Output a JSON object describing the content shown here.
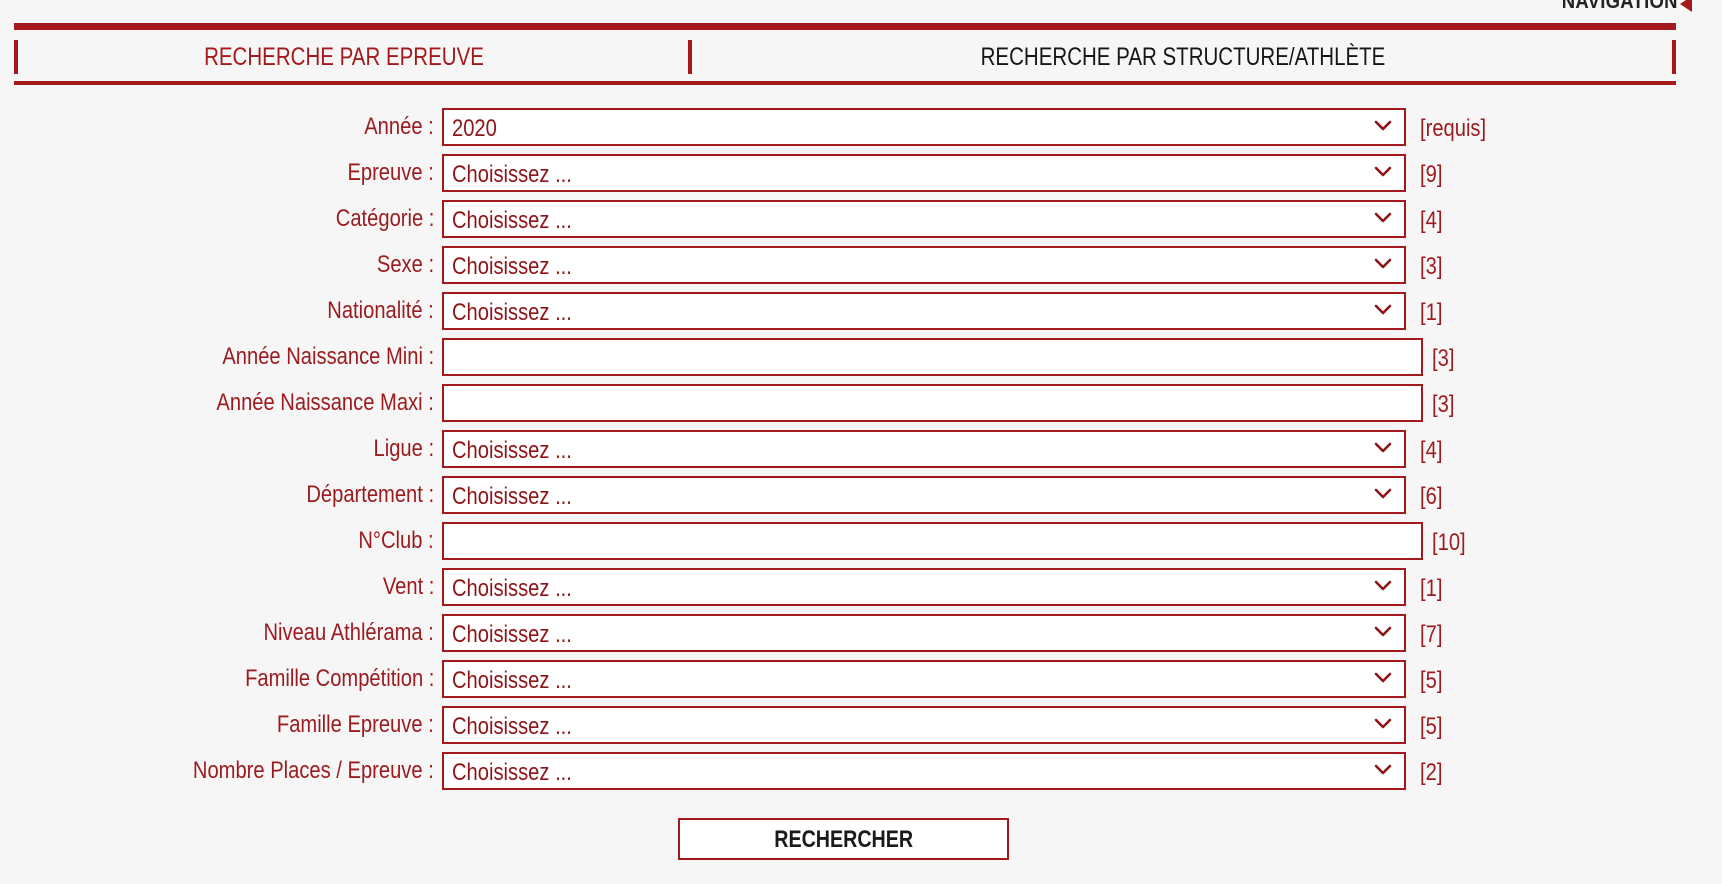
{
  "navigation": {
    "label": "NAVIGATION"
  },
  "tabs": [
    {
      "label": "RECHERCHE PAR EPREUVE",
      "active": true
    },
    {
      "label": "RECHERCHE PAR STRUCTURE/ATHLÈTE",
      "active": false
    }
  ],
  "form": {
    "fields": [
      {
        "label": "Année :",
        "type": "select",
        "value": "2020",
        "hint": "[requis]"
      },
      {
        "label": "Epreuve :",
        "type": "select",
        "value": "Choisissez ...",
        "hint": "[9]"
      },
      {
        "label": "Catégorie :",
        "type": "select",
        "value": "Choisissez ...",
        "hint": "[4]"
      },
      {
        "label": "Sexe :",
        "type": "select",
        "value": "Choisissez ...",
        "hint": "[3]"
      },
      {
        "label": "Nationalité :",
        "type": "select",
        "value": "Choisissez ...",
        "hint": "[1]"
      },
      {
        "label": "Année Naissance Mini :",
        "type": "text",
        "value": "",
        "hint": "[3]"
      },
      {
        "label": "Année Naissance Maxi :",
        "type": "text",
        "value": "",
        "hint": "[3]"
      },
      {
        "label": "Ligue :",
        "type": "select",
        "value": "Choisissez ...",
        "hint": "[4]"
      },
      {
        "label": "Département :",
        "type": "select",
        "value": "Choisissez ...",
        "hint": "[6]"
      },
      {
        "label": "N°Club :",
        "type": "text",
        "value": "",
        "hint": "[10]"
      },
      {
        "label": "Vent :",
        "type": "select",
        "value": "Choisissez ...",
        "hint": "[1]"
      },
      {
        "label": "Niveau Athlérama :",
        "type": "select",
        "value": "Choisissez ...",
        "hint": "[7]"
      },
      {
        "label": "Famille Compétition :",
        "type": "select",
        "value": "Choisissez ...",
        "hint": "[5]"
      },
      {
        "label": "Famille Epreuve :",
        "type": "select",
        "value": "Choisissez ...",
        "hint": "[5]"
      },
      {
        "label": "Nombre Places / Epreuve :",
        "type": "select",
        "value": "Choisissez ...",
        "hint": "[2]"
      }
    ],
    "submit_label": "RECHERCHER"
  },
  "colors": {
    "accent": "#a3191c",
    "label_text": "#9b1b1f",
    "background": "#f6f6f6"
  }
}
